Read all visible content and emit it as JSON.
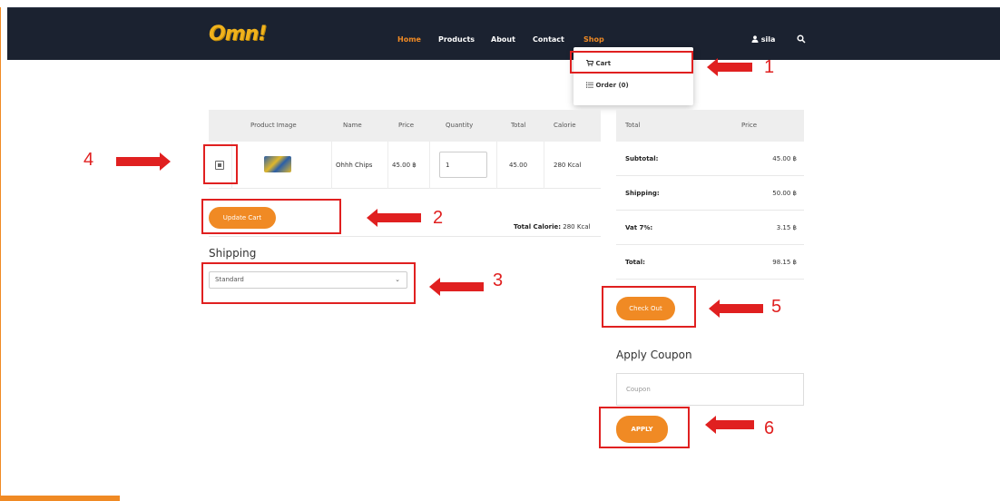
{
  "nav": {
    "logo": "Omn!",
    "links": [
      "Home",
      "Products",
      "About",
      "Contact",
      "Shop"
    ],
    "user": "sila"
  },
  "dropdown": {
    "items": [
      "Cart",
      "Order (0)"
    ]
  },
  "cart_table": {
    "headers": [
      "Product Image",
      "Name",
      "Price",
      "Quantity",
      "Total",
      "Calorie"
    ],
    "row": {
      "name": "Ohhh Chips",
      "price": "45.00 ฿",
      "quantity": "1",
      "total": "45.00",
      "calorie": "280 Kcal"
    }
  },
  "update_cart_label": "Update Cart",
  "total_calorie": {
    "label": "Total Calorie:",
    "value": "280 Kcal"
  },
  "shipping": {
    "heading": "Shipping",
    "selected": "Standard"
  },
  "summary": {
    "headers": [
      "Total",
      "Price"
    ],
    "rows": [
      {
        "label": "Subtotal:",
        "value": "45.00 ฿"
      },
      {
        "label": "Shipping:",
        "value": "50.00 ฿"
      },
      {
        "label": "Vat 7%:",
        "value": "3.15 ฿"
      },
      {
        "label": "Total:",
        "value": "98.15 ฿"
      }
    ]
  },
  "checkout_label": "Check Out",
  "coupon": {
    "heading": "Apply Coupon",
    "placeholder": "Coupon",
    "apply_label": "APPLY"
  },
  "annotations": [
    "1",
    "2",
    "3",
    "4",
    "5",
    "6"
  ],
  "colors": {
    "accent": "#f08a24",
    "nav_bg": "#1b2230",
    "annotation": "#e02020"
  }
}
